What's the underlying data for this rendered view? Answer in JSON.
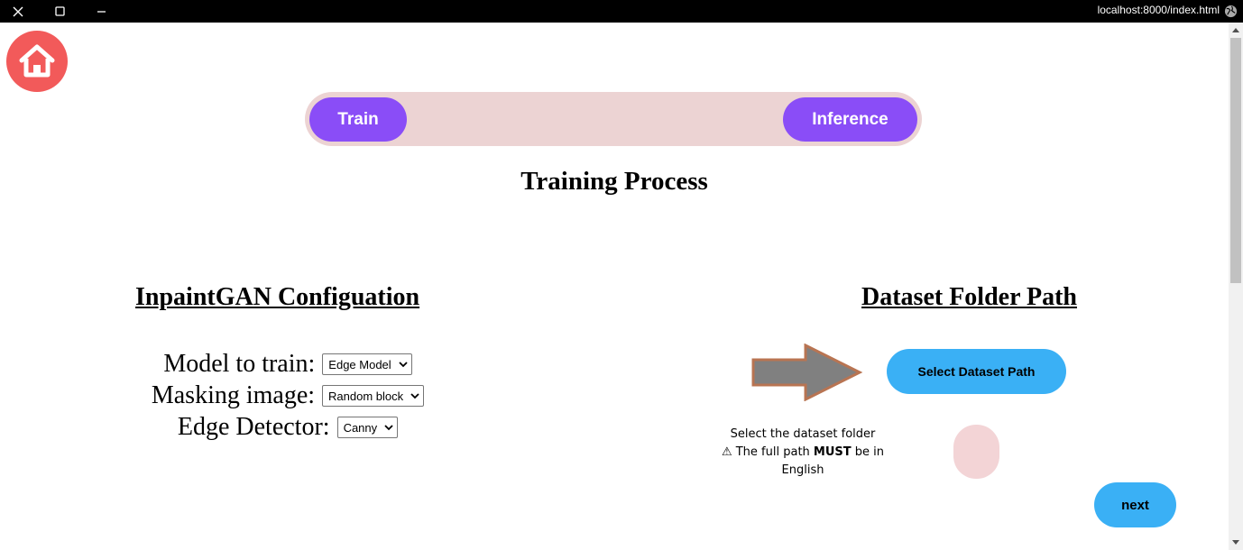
{
  "window": {
    "url": "localhost:8000/index.html"
  },
  "mode_toggle": {
    "train_label": "Train",
    "inference_label": "Inference"
  },
  "page_title": "Training Process",
  "config": {
    "heading": "InpaintGAN Configuation",
    "rows": [
      {
        "label": "Model to train:",
        "value": "Edge Model"
      },
      {
        "label": "Masking image:",
        "value": "Random block"
      },
      {
        "label": "Edge Detector:",
        "value": "Canny"
      }
    ]
  },
  "dataset": {
    "heading": "Dataset Folder Path",
    "button_label": "Select Dataset Path",
    "hint_line1": "Select the dataset folder",
    "hint_warning_prefix": "⚠ The full path ",
    "hint_emphasis": "MUST",
    "hint_warning_suffix": " be in English"
  },
  "next_label": "next",
  "colors": {
    "toggle_track": "#ecd3d3",
    "pill": "#8a4df7",
    "home": "#f25a5a",
    "blue_button": "#3ab0f5",
    "arrow_fill": "#808080",
    "arrow_border": "#b87452"
  },
  "icons": [
    "close-icon",
    "maximize-icon",
    "minimize-icon",
    "globe-icon",
    "home-icon",
    "arrow-right-icon",
    "chevron-down-icon"
  ]
}
